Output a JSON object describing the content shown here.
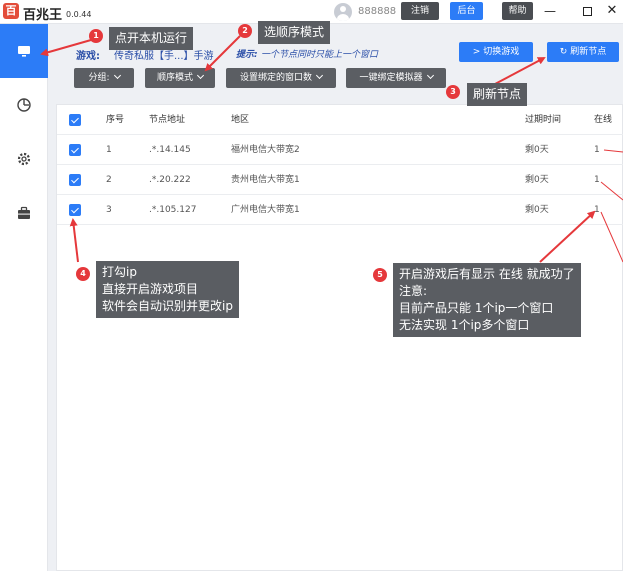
{
  "titlebar": {
    "logo_text": "百",
    "app_name": "百兆王",
    "version": "0.0.44",
    "username": "888888",
    "logout_label": "注销",
    "backend_label": "后台",
    "help_label": "帮助",
    "min_icon": "minimize-icon",
    "max_icon": "maximize-icon",
    "close_icon": "close-icon",
    "close_glyph": "✕",
    "min_glyph": "—"
  },
  "sidebar": {
    "items": [
      {
        "icon": "monitor-icon",
        "active": true
      },
      {
        "icon": "clock-icon",
        "active": false
      },
      {
        "icon": "gear-icon",
        "active": false
      },
      {
        "icon": "briefcase-icon",
        "active": false
      }
    ]
  },
  "header": {
    "game_label": "游戏:",
    "game_value": "传奇私服【手...】手游",
    "hint_label": "提示:",
    "hint_value": "一个节点同时只能上一个窗口",
    "switch_game_label": "> 切换游戏",
    "refresh_node_label": "↻ 刷新节点",
    "dropdowns": {
      "group": "分组:",
      "sequence": "顺序模式",
      "bind_windows": "设置绑定的窗口数",
      "bind_emulator": "一键绑定模拟器"
    }
  },
  "table": {
    "headers": {
      "index": "序号",
      "address": "节点地址",
      "region": "地区",
      "expiry": "过期时间",
      "online": "在线"
    },
    "rows": [
      {
        "index": "1",
        "address": ".*.14.145",
        "region": "福州电信大带宽2",
        "expiry": "剩0天",
        "online": "1",
        "checked": true
      },
      {
        "index": "2",
        "address": ".*.20.222",
        "region": "贵州电信大带宽1",
        "expiry": "剩0天",
        "online": "1",
        "checked": true
      },
      {
        "index": "3",
        "address": ".*.105.127",
        "region": "广州电信大带宽1",
        "expiry": "剩0天",
        "online": "1",
        "checked": true
      }
    ]
  },
  "annotations": {
    "n1": {
      "badge": "1",
      "text": "点开本机运行"
    },
    "n2": {
      "badge": "2",
      "text": "选顺序模式"
    },
    "n3": {
      "badge": "3",
      "text": "刷新节点"
    },
    "n4": {
      "badge": "4",
      "lines": [
        "打勾ip",
        "直接开启游戏项目",
        "软件会自动识别并更改ip"
      ]
    },
    "n5": {
      "badge": "5",
      "lines": [
        "开启游戏后有显示 在线 就成功了",
        "注意:",
        "目前产品只能 1个ip一个窗口",
        "无法实现 1个ip多个窗口"
      ]
    }
  },
  "colors": {
    "accent": "#2c7cf7",
    "annotation_red": "#e5383b",
    "dark_button": "#5b5e63"
  }
}
